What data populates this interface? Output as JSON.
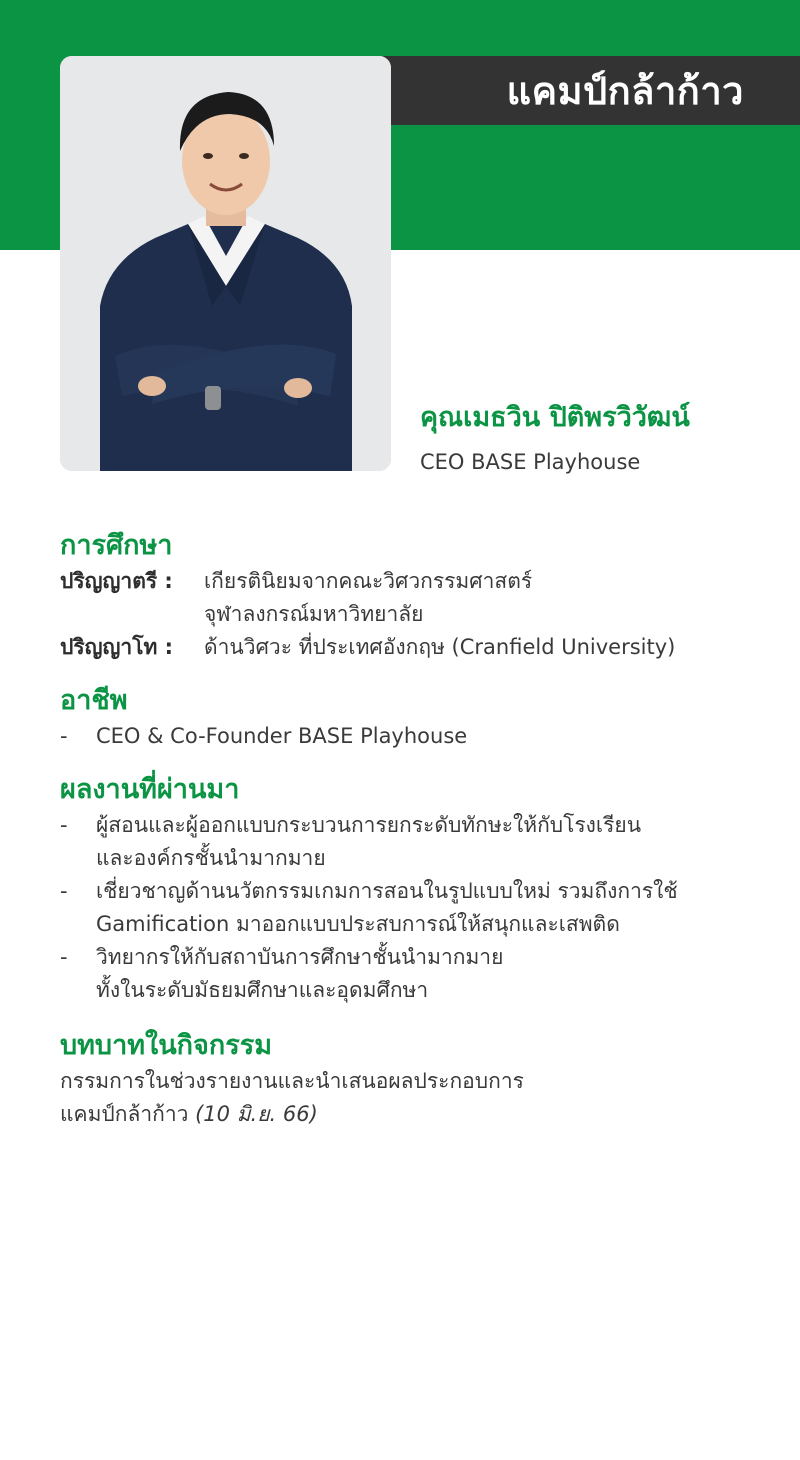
{
  "banner": {
    "title": "แคมป์กล้าก้าว"
  },
  "profile": {
    "name": "คุณเมธวิน ปิติพรวิวัฒน์",
    "position": "CEO BASE Playhouse"
  },
  "education": {
    "heading": "การศึกษา",
    "rows": [
      {
        "label": "ปริญญาตรี :",
        "lines": [
          "เกียรตินิยมจากคณะวิศวกรรมศาสตร์",
          "จุฬาลงกรณ์มหาวิทยาลัย"
        ]
      },
      {
        "label": "ปริญญาโท :",
        "lines": [
          "ด้านวิศวะ ที่ประเทศอังกฤษ (Cranfield University)"
        ]
      }
    ]
  },
  "career": {
    "heading": "อาชีพ",
    "items": [
      "CEO & Co-Founder BASE Playhouse"
    ]
  },
  "achievements": {
    "heading": "ผลงานที่ผ่านมา",
    "items": [
      [
        "ผู้สอนและผู้ออกแบบกระบวนการยกระดับทักษะให้กับโรงเรียน",
        "และองค์กรชั้นนำมากมาย"
      ],
      [
        "เชี่ยวชาญด้านนวัตกรรมเกมการสอนในรูปแบบใหม่ รวมถึงการใช้",
        "Gamification มาออกแบบประสบการณ์ให้สนุกและเสพติด"
      ],
      [
        "วิทยากรให้กับสถาบันการศึกษาชั้นนำมากมาย",
        "ทั้งในระดับมัธยมศึกษาและอุดมศึกษา"
      ]
    ]
  },
  "role": {
    "heading": "บทบาทในกิจกรรม",
    "line1": "กรรมการในช่วงรายงานและนำเสนอผลประกอบการ",
    "line2_text": "แคมป์กล้าก้าว ",
    "line2_date": "(10 มิ.ย. 66)"
  },
  "colors": {
    "brand_green": "#0b9444",
    "banner_dark": "#333333"
  }
}
